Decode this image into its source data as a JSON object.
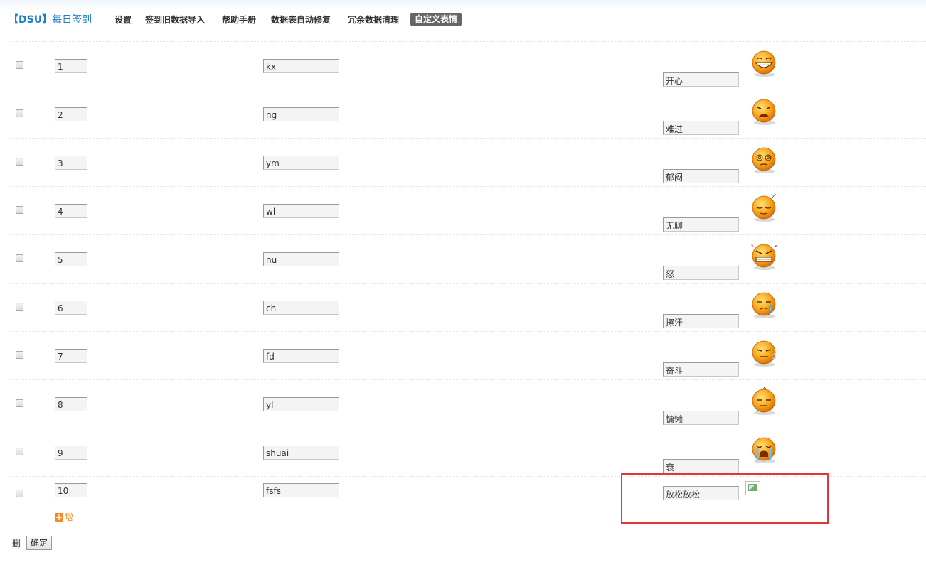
{
  "header": {
    "brand_prefix": "【DSU】",
    "brand_name": "每日签到",
    "nav": [
      {
        "label": "设置",
        "active": false
      },
      {
        "label": "签到旧数据导入",
        "active": false
      },
      {
        "label": "帮助手册",
        "active": false
      },
      {
        "label": "数据表自动修复",
        "active": false
      },
      {
        "label": "冗余数据清理",
        "active": false
      },
      {
        "label": "自定义表情",
        "active": true
      }
    ]
  },
  "emotions": [
    {
      "order": "1",
      "code": "kx",
      "name": "开心",
      "icon": "grinning-face-icon"
    },
    {
      "order": "2",
      "code": "ng",
      "name": "难过",
      "icon": "sad-face-icon"
    },
    {
      "order": "3",
      "code": "ym",
      "name": "郁闷",
      "icon": "dizzy-face-icon"
    },
    {
      "order": "4",
      "code": "wl",
      "name": "无聊",
      "icon": "sleepy-face-icon"
    },
    {
      "order": "5",
      "code": "nu",
      "name": "怒",
      "icon": "angry-face-icon"
    },
    {
      "order": "6",
      "code": "ch",
      "name": "擦汗",
      "icon": "sweat-face-icon"
    },
    {
      "order": "7",
      "code": "fd",
      "name": "奋斗",
      "icon": "striving-face-icon"
    },
    {
      "order": "8",
      "code": "yl",
      "name": "慵懒",
      "icon": "lazy-face-icon"
    },
    {
      "order": "9",
      "code": "shuai",
      "name": "衰",
      "icon": "crying-face-icon"
    },
    {
      "order": "10",
      "code": "fsfs",
      "name": "放松放松",
      "icon": "broken-image-icon"
    }
  ],
  "add_label": "增",
  "delete_label": "删",
  "submit_label": "确定",
  "colors": {
    "accent": "#1a82c4",
    "add": "#f48a1b",
    "highlight": "#e0353a"
  }
}
